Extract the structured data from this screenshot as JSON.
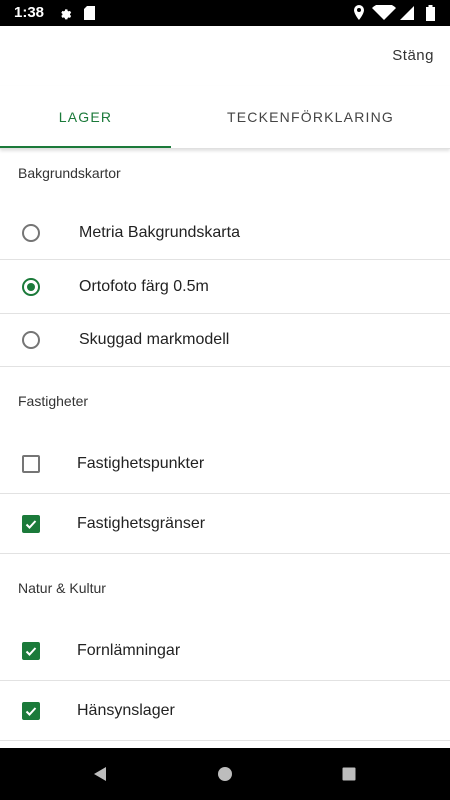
{
  "status_bar": {
    "time": "1:38"
  },
  "app_bar": {
    "close_label": "Stäng"
  },
  "tabs": [
    {
      "label": "LAGER",
      "selected": true
    },
    {
      "label": "TECKENFÖRKLARING",
      "selected": false
    }
  ],
  "sections": {
    "background_maps": {
      "title": "Bakgrundskartor",
      "options": [
        {
          "label": "Metria Bakgrundskarta",
          "selected": false
        },
        {
          "label": "Ortofoto färg 0.5m",
          "selected": true
        },
        {
          "label": "Skuggad markmodell",
          "selected": false
        }
      ]
    },
    "properties": {
      "title": "Fastigheter",
      "options": [
        {
          "label": "Fastighetspunkter",
          "checked": false
        },
        {
          "label": "Fastighetsgränser",
          "checked": true
        }
      ]
    },
    "nature_culture": {
      "title": "Natur & Kultur",
      "options": [
        {
          "label": "Fornlämningar",
          "checked": true
        },
        {
          "label": "Hänsynslager",
          "checked": true
        }
      ]
    }
  },
  "colors": {
    "accent": "#1b7a3a",
    "status_bar": "#000000",
    "nav_bar": "#000000"
  }
}
